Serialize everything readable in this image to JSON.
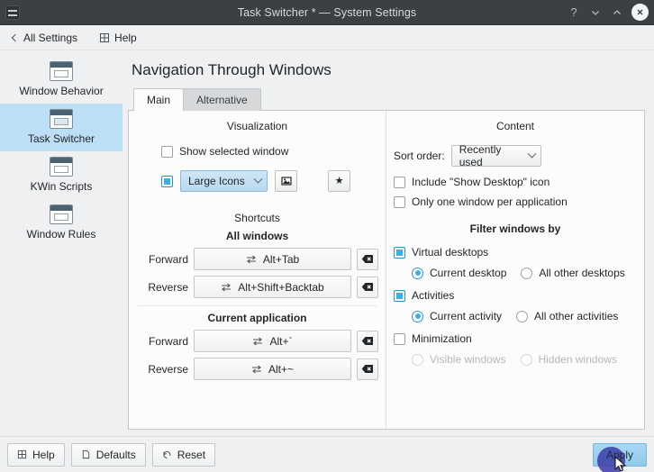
{
  "window": {
    "title": "Task Switcher * — System Settings",
    "app_icon": "settings-sliders-icon",
    "buttons": {
      "help": "?",
      "minimize": "chevron-down-icon",
      "maximize": "chevron-up-icon",
      "close": "close-icon"
    }
  },
  "toolbar": {
    "back_label": "All Settings",
    "help_label": "Help"
  },
  "sidebar": {
    "items": [
      {
        "label": "Window Behavior",
        "selected": false
      },
      {
        "label": "Task Switcher",
        "selected": true
      },
      {
        "label": "KWin Scripts",
        "selected": false
      },
      {
        "label": "Window Rules",
        "selected": false
      }
    ]
  },
  "page": {
    "title": "Navigation Through Windows",
    "tabs": [
      {
        "label": "Main",
        "active": true
      },
      {
        "label": "Alternative",
        "active": false
      }
    ]
  },
  "visualization": {
    "heading": "Visualization",
    "show_selected_window": {
      "label": "Show selected window",
      "checked": false
    },
    "effect_enabled": {
      "checked": true
    },
    "effect_combo": {
      "value": "Large Icons",
      "focused": true
    },
    "preview_button": "image-preview-icon",
    "star_button": "star-icon"
  },
  "shortcuts": {
    "heading": "Shortcuts",
    "groups": [
      {
        "title": "All windows",
        "rows": [
          {
            "label": "Forward",
            "value": "Alt+Tab"
          },
          {
            "label": "Reverse",
            "value": "Alt+Shift+Backtab"
          }
        ]
      },
      {
        "title": "Current application",
        "rows": [
          {
            "label": "Forward",
            "value": "Alt+`"
          },
          {
            "label": "Reverse",
            "value": "Alt+~"
          }
        ]
      }
    ],
    "clear_icon": "backspace-clear-icon",
    "shortcut_icon": "swap-arrows-icon"
  },
  "content": {
    "heading": "Content",
    "sort_order_label": "Sort order:",
    "sort_order_value": "Recently used",
    "include_show_desktop": {
      "label": "Include \"Show Desktop\" icon",
      "checked": false
    },
    "only_one_window": {
      "label": "Only one window per application",
      "checked": false
    }
  },
  "filter": {
    "heading": "Filter windows by",
    "virtual_desktops": {
      "label": "Virtual desktops",
      "checked": true
    },
    "desktop_options": [
      {
        "label": "Current desktop",
        "selected": true,
        "disabled": false
      },
      {
        "label": "All other desktops",
        "selected": false,
        "disabled": false
      }
    ],
    "activities": {
      "label": "Activities",
      "checked": true
    },
    "activity_options": [
      {
        "label": "Current activity",
        "selected": true,
        "disabled": false
      },
      {
        "label": "All other activities",
        "selected": false,
        "disabled": false
      }
    ],
    "minimization": {
      "label": "Minimization",
      "checked": false
    },
    "minimization_options": [
      {
        "label": "Visible windows",
        "selected": false,
        "disabled": true
      },
      {
        "label": "Hidden windows",
        "selected": false,
        "disabled": true
      }
    ]
  },
  "footer": {
    "help": "Help",
    "defaults": "Defaults",
    "reset": "Reset",
    "apply": "Apply"
  },
  "colors": {
    "accent": "#3daee9",
    "selection": "#bcdef7",
    "titlebar": "#3b4045",
    "window_bg": "#eff0f1"
  }
}
